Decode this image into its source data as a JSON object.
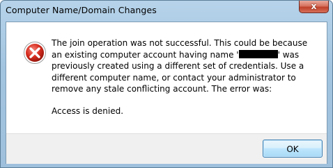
{
  "window": {
    "title": "Computer Name/Domain Changes",
    "close_glyph": "x"
  },
  "dialog": {
    "icon": "error-icon",
    "message_part1": "The join operation was not successful. This could be because an existing computer account having name '",
    "message_part2": "' was previously created using a different set of credentials. Use a different computer name, or contact your administrator to remove any stale conflicting account.  The error was:",
    "detail": "Access is denied."
  },
  "buttons": {
    "ok_label": "OK"
  }
}
